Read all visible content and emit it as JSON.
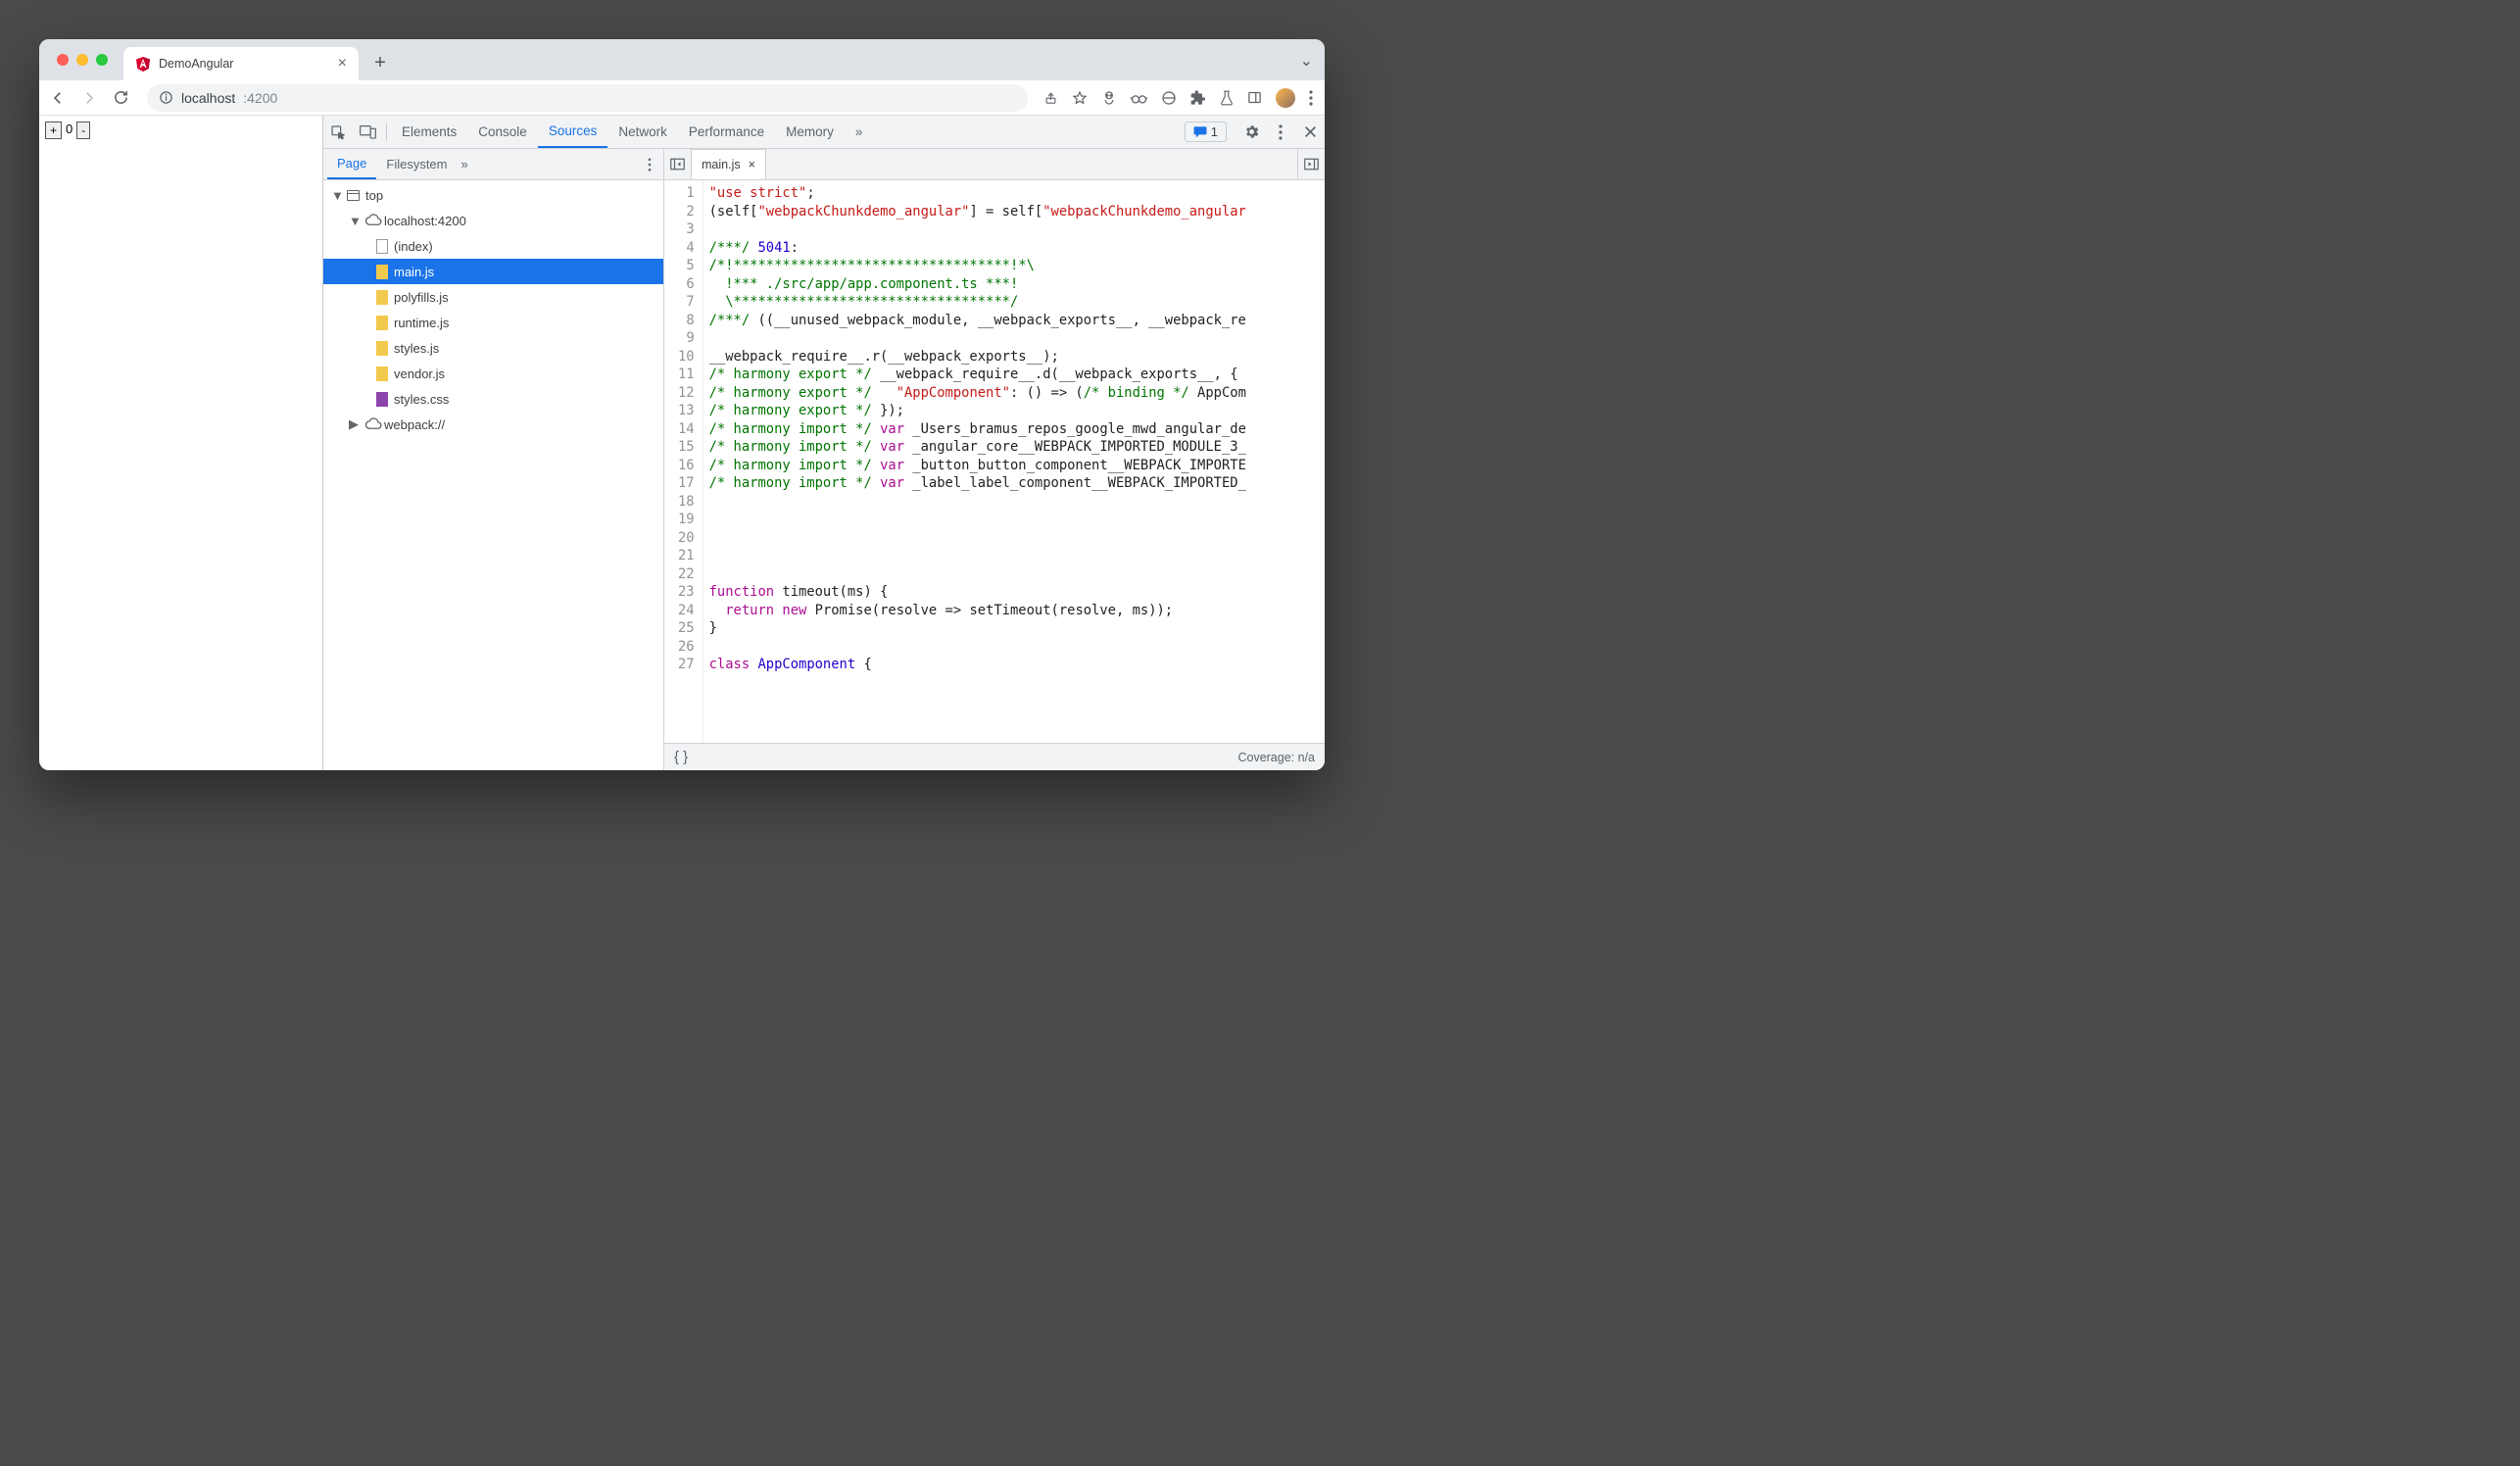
{
  "browser": {
    "tab_title": "DemoAngular",
    "url_host": "localhost",
    "url_port": ":4200"
  },
  "page": {
    "plus": "+",
    "counter": "0",
    "minus": "-"
  },
  "devtools": {
    "tabs": [
      "Elements",
      "Console",
      "Sources",
      "Network",
      "Performance",
      "Memory"
    ],
    "active_tab": "Sources",
    "issues_count": "1",
    "nav": {
      "tabs": [
        "Page",
        "Filesystem"
      ],
      "active": "Page",
      "tree": {
        "top": "top",
        "host": "localhost:4200",
        "files": [
          "(index)",
          "main.js",
          "polyfills.js",
          "runtime.js",
          "styles.js",
          "vendor.js",
          "styles.css"
        ],
        "selected": "main.js",
        "webpack": "webpack://"
      }
    },
    "editor": {
      "open_file": "main.js",
      "line_count": 27,
      "lines": [
        [
          [
            "str",
            "\"use strict\""
          ],
          [
            "",
            ";"
          ]
        ],
        [
          [
            "",
            "(self["
          ],
          [
            "str",
            "\"webpackChunkdemo_angular\""
          ],
          [
            "",
            "] = self["
          ],
          [
            "str",
            "\"webpackChunkdemo_angular"
          ]
        ],
        [
          [
            "",
            ""
          ]
        ],
        [
          [
            "com",
            "/***/ "
          ],
          [
            "idx",
            "5041"
          ],
          [
            "",
            ":"
          ]
        ],
        [
          [
            "com",
            "/*!**********************************!*\\"
          ]
        ],
        [
          [
            "com",
            "  !*** ./src/app/app.component.ts ***!"
          ]
        ],
        [
          [
            "com",
            "  \\**********************************/"
          ]
        ],
        [
          [
            "com",
            "/***/"
          ],
          [
            "",
            " ((__unused_webpack_module, __webpack_exports__, __webpack_re"
          ]
        ],
        [
          [
            "",
            ""
          ]
        ],
        [
          [
            "",
            "__webpack_require__.r(__webpack_exports__);"
          ]
        ],
        [
          [
            "com",
            "/* harmony export */"
          ],
          [
            "",
            " __webpack_require__.d(__webpack_exports__, {"
          ]
        ],
        [
          [
            "com",
            "/* harmony export */"
          ],
          [
            "",
            "   "
          ],
          [
            "str",
            "\"AppComponent\""
          ],
          [
            "",
            ": () => ("
          ],
          [
            "com",
            "/* binding */"
          ],
          [
            "",
            " AppCom"
          ]
        ],
        [
          [
            "com",
            "/* harmony export */"
          ],
          [
            "",
            " });"
          ]
        ],
        [
          [
            "com",
            "/* harmony import */"
          ],
          [
            "",
            " "
          ],
          [
            "kw",
            "var"
          ],
          [
            "",
            " _Users_bramus_repos_google_mwd_angular_de"
          ]
        ],
        [
          [
            "com",
            "/* harmony import */"
          ],
          [
            "",
            " "
          ],
          [
            "kw",
            "var"
          ],
          [
            "",
            " _angular_core__WEBPACK_IMPORTED_MODULE_3_"
          ]
        ],
        [
          [
            "com",
            "/* harmony import */"
          ],
          [
            "",
            " "
          ],
          [
            "kw",
            "var"
          ],
          [
            "",
            " _button_button_component__WEBPACK_IMPORTE"
          ]
        ],
        [
          [
            "com",
            "/* harmony import */"
          ],
          [
            "",
            " "
          ],
          [
            "kw",
            "var"
          ],
          [
            "",
            " _label_label_component__WEBPACK_IMPORTED_"
          ]
        ],
        [
          [
            "",
            ""
          ]
        ],
        [
          [
            "",
            ""
          ]
        ],
        [
          [
            "",
            ""
          ]
        ],
        [
          [
            "",
            ""
          ]
        ],
        [
          [
            "",
            ""
          ]
        ],
        [
          [
            "kw",
            "function"
          ],
          [
            "",
            " timeout(ms) {"
          ]
        ],
        [
          [
            "",
            "  "
          ],
          [
            "kw",
            "return"
          ],
          [
            "",
            " "
          ],
          [
            "kw",
            "new"
          ],
          [
            "",
            " Promise(resolve => setTimeout(resolve, ms));"
          ]
        ],
        [
          [
            "",
            "}"
          ]
        ],
        [
          [
            "",
            ""
          ]
        ],
        [
          [
            "kw",
            "class"
          ],
          [
            "",
            " "
          ],
          [
            "idx",
            "AppComponent"
          ],
          [
            "",
            " {"
          ]
        ]
      ]
    },
    "footer": {
      "coverage": "Coverage: n/a"
    }
  }
}
